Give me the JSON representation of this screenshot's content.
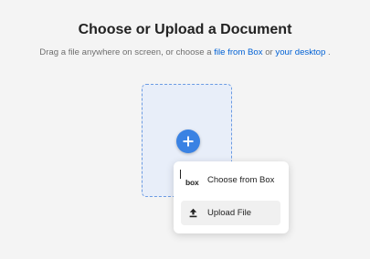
{
  "header": {
    "title": "Choose or Upload a Document",
    "subtitle_prefix": "Drag a file anywhere on screen, or choose a ",
    "link_box": "file from Box",
    "subtitle_middle": " or ",
    "link_desktop": "your desktop",
    "subtitle_suffix": " ."
  },
  "upload_menu": {
    "items": [
      {
        "label": "Choose from Box",
        "icon": "box-logo-icon",
        "logo_text": "box"
      },
      {
        "label": "Upload File",
        "icon": "upload-icon"
      }
    ]
  },
  "colors": {
    "accent": "#3a82e3",
    "link": "#0061d5",
    "dropzone_fill": "#e8eef9",
    "dropzone_border": "#6b9be3",
    "background": "#f4f4f4"
  }
}
